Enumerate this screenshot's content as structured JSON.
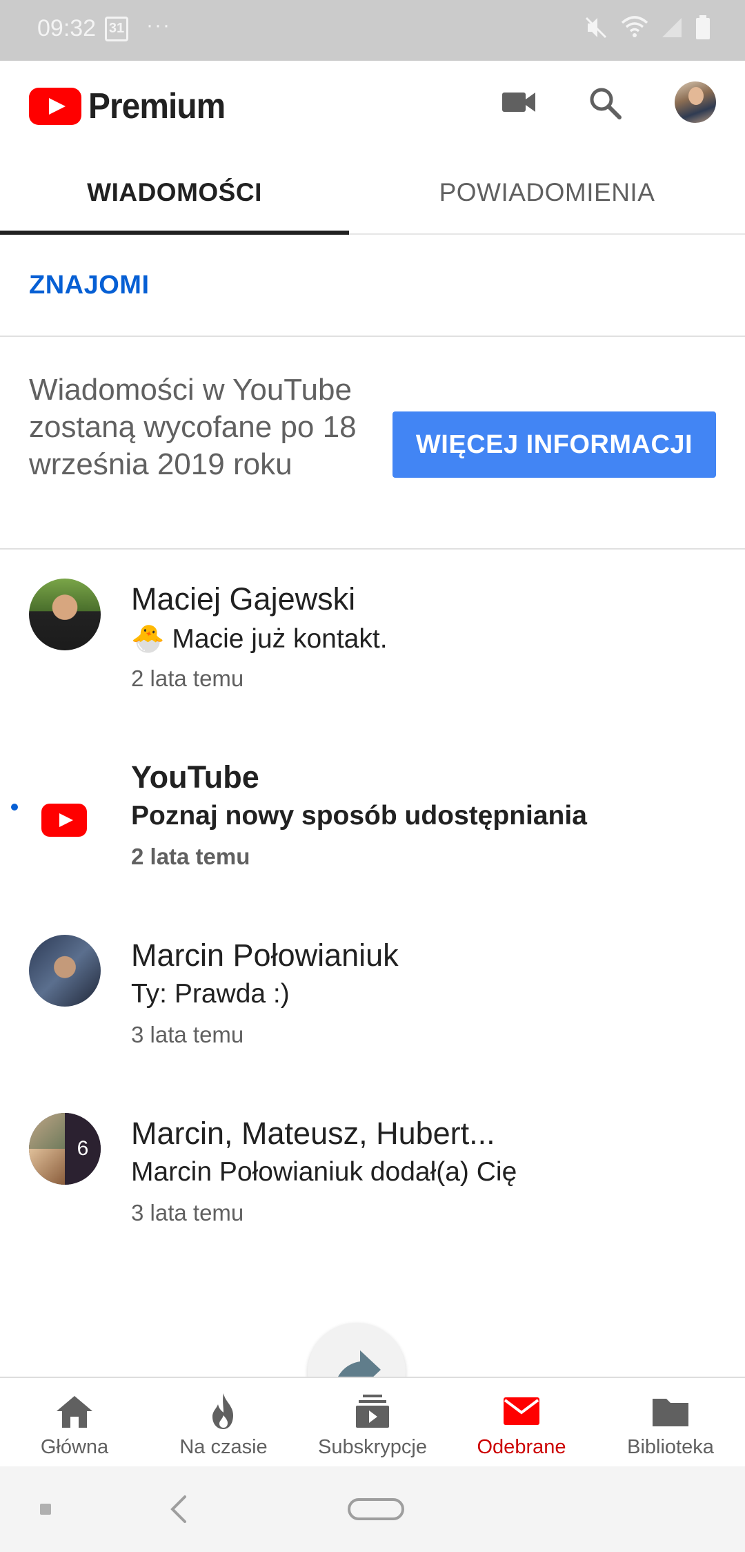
{
  "status_bar": {
    "time": "09:32",
    "calendar_day": "31",
    "dots": "···"
  },
  "app_bar": {
    "brand": "Premium",
    "icons": [
      "video-camera-icon",
      "search-icon",
      "account-avatar"
    ]
  },
  "tabs": [
    {
      "label": "WIADOMOŚCI",
      "active": true
    },
    {
      "label": "POWIADOMIENIA",
      "active": false
    }
  ],
  "friends": {
    "label": "ZNAJOMI"
  },
  "banner": {
    "text": "Wiadomości w YouTube zostaną wycofane po 18 września 2019 roku",
    "button": "WIĘCEJ INFORMACJI"
  },
  "messages": [
    {
      "name": "Maciej Gajewski",
      "emoji": "🐣",
      "preview": "Macie już kontakt.",
      "time": "2 lata temu",
      "unread": false
    },
    {
      "name": "YouTube",
      "preview": "Poznaj nowy sposób udostępniania",
      "time": "2 lata temu",
      "unread": true
    },
    {
      "name": "Marcin Połowianiuk",
      "preview": "Ty: Prawda :)",
      "time": "3 lata temu",
      "unread": false
    },
    {
      "name": "Marcin, Mateusz, Hubert...",
      "preview": "Marcin Połowianiuk dodał(a) Cię",
      "time": "3 lata temu",
      "unread": false,
      "group_count": "6"
    }
  ],
  "bottom_nav": [
    {
      "label": "Główna",
      "icon": "home-icon",
      "active": false
    },
    {
      "label": "Na czasie",
      "icon": "flame-icon",
      "active": false
    },
    {
      "label": "Subskrypcje",
      "icon": "subscriptions-icon",
      "active": false
    },
    {
      "label": "Odebrane",
      "icon": "inbox-icon",
      "active": true
    },
    {
      "label": "Biblioteka",
      "icon": "folder-icon",
      "active": false
    }
  ],
  "colors": {
    "accent_blue": "#065fd4",
    "button_blue": "#4285f4",
    "youtube_red": "#ff0000",
    "active_nav": "#cc0000"
  }
}
